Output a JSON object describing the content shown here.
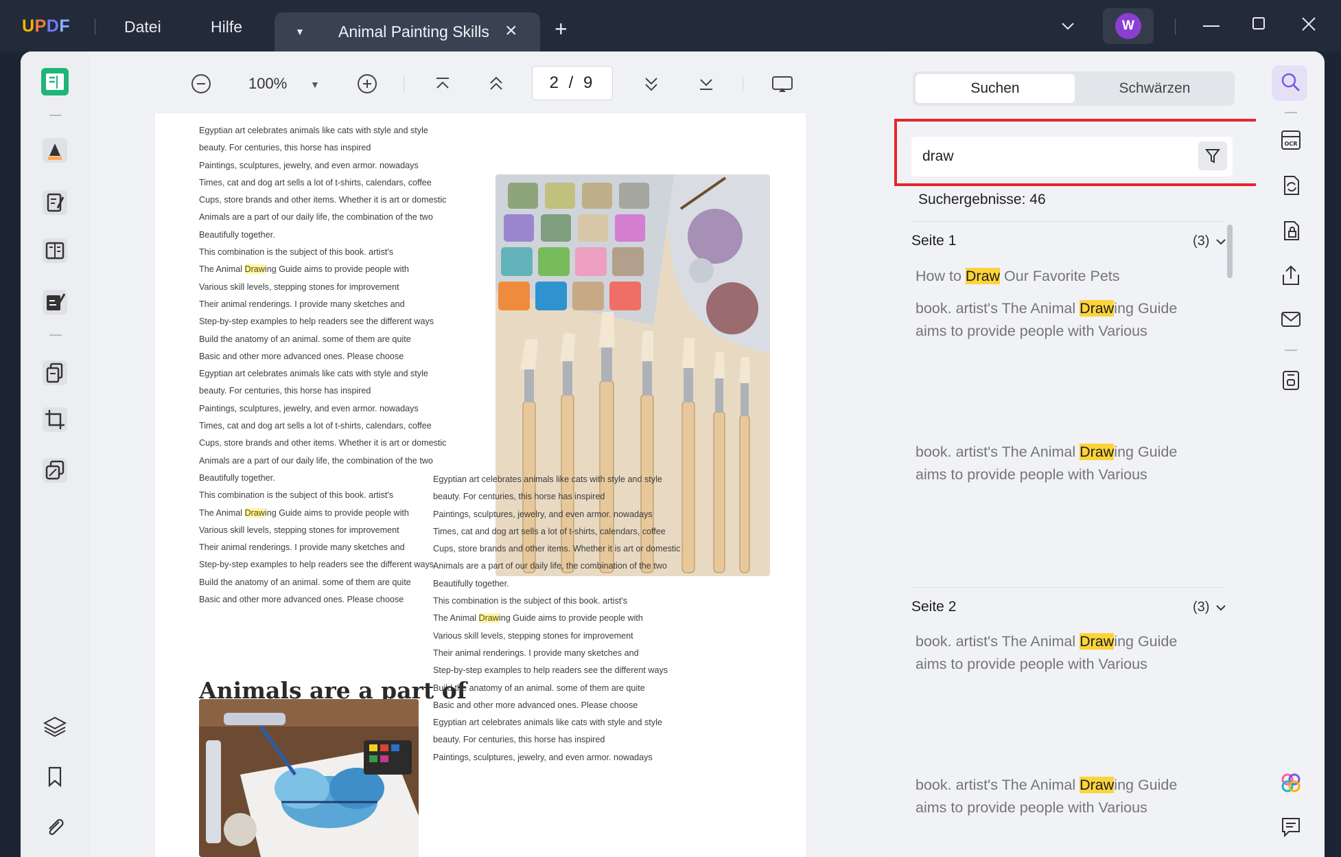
{
  "titlebar": {
    "logo": {
      "u": "U",
      "p": "P",
      "d": "D",
      "f": "F"
    },
    "menu": [
      "Datei",
      "Hilfe"
    ],
    "tab_title": "Animal Painting Skills",
    "avatar_letter": "W"
  },
  "toolbar": {
    "zoom": "100%",
    "page_indicator": "2 / 9"
  },
  "search_panel": {
    "tabs": {
      "search": "Suchen",
      "redact": "Schwärzen"
    },
    "query": "draw",
    "results_count": "Suchergebnisse: 46",
    "sections": [
      {
        "title": "Seite 1",
        "count": "(3)",
        "results": [
          {
            "before": "How to ",
            "match": "Draw",
            "after": " Our Favorite Pets"
          },
          {
            "before": "book. artist's The Animal ",
            "match": "Draw",
            "after": "ing Guide aims to provide people with Various"
          },
          {
            "before": "book. artist's The Animal ",
            "match": "Draw",
            "after": "ing Guide aims to provide people with Various"
          }
        ]
      },
      {
        "title": "Seite 2",
        "count": "(3)",
        "results": [
          {
            "before": "book. artist's The Animal ",
            "match": "Draw",
            "after": "ing Guide aims to provide people with Various"
          },
          {
            "before": "book. artist's The Animal ",
            "match": "Draw",
            "after": "ing Guide aims to provide people with Various"
          }
        ]
      }
    ]
  },
  "document": {
    "left_column": [
      "Egyptian art celebrates animals like cats with style and style",
      "beauty. For centuries, this horse has inspired",
      "Paintings, sculptures, jewelry, and even armor. nowadays",
      "Times, cat and dog art sells a lot of t-shirts, calendars, coffee",
      "Cups, store brands and other items. Whether it is art or domestic",
      "Animals are a part of our daily life, the combination of the two",
      "Beautifully together.",
      "This combination is the subject of this book. artist's",
      "The Animal |Draw|ing Guide aims to provide people with",
      "Various skill levels, stepping stones for improvement",
      "Their animal renderings. I provide many sketches and",
      "Step-by-step examples to help readers see the different ways",
      "Build the anatomy of an animal. some of them are quite",
      "Basic and other more advanced ones. Please choose",
      "Egyptian art celebrates animals like cats with style and style",
      "beauty. For centuries, this horse has inspired",
      "Paintings, sculptures, jewelry, and even armor. nowadays",
      "Times, cat and dog art sells a lot of t-shirts, calendars, coffee",
      "Cups, store brands and other items. Whether it is art or domestic",
      "Animals are a part of our daily life, the combination of the two",
      "Beautifully together.",
      "This combination is the subject of this book. artist's",
      "The Animal |Draw|ing Guide aims to provide people with",
      "Various skill levels, stepping stones for improvement",
      "Their animal renderings. I provide many sketches and",
      "Step-by-step examples to help readers see the different ways",
      "Build the anatomy of an animal. some of them are quite",
      "Basic and other more advanced ones. Please choose"
    ],
    "heading": "Animals are a part of our daily life",
    "right_column": [
      "Egyptian art celebrates animals like cats with style and style",
      "beauty. For centuries, this horse has inspired",
      "Paintings, sculptures, jewelry, and even armor. nowadays",
      "Times, cat and dog art sells a lot of t-shirts, calendars, coffee",
      "Cups, store brands and other items. Whether it is art or domestic",
      "Animals are a part of our daily life, the combination of the two",
      "Beautifully together.",
      "This combination is the subject of this book. artist's",
      "The Animal |Draw|ing Guide aims to provide people with",
      "Various skill levels, stepping stones for improvement",
      "Their animal renderings. I provide many sketches and",
      "Step-by-step examples to help readers see the different ways",
      "Build the anatomy of an animal. some of them are quite",
      "Basic and other more advanced ones. Please choose",
      "Egyptian art celebrates animals like cats with style and style",
      "beauty. For centuries, this horse has inspired",
      "Paintings, sculptures, jewelry, and even armor. nowadays"
    ]
  },
  "icons": {
    "left_rail": [
      "reader-icon",
      "highlighter-icon",
      "edit-text-icon",
      "form-icon",
      "sign-icon",
      "organize-pages-icon",
      "crop-icon",
      "compress-icon",
      "layers-icon",
      "bookmark-icon",
      "attachment-icon"
    ],
    "right_rail": [
      "search-icon",
      "ocr-icon",
      "convert-icon",
      "protect-icon",
      "share-icon",
      "mail-icon",
      "save-icon",
      "ai-assistant-icon",
      "comment-icon"
    ]
  },
  "colors": {
    "accent": "#7b57e0",
    "highlight_box": "#e4262c",
    "match_highlight": "#fcd43a"
  }
}
